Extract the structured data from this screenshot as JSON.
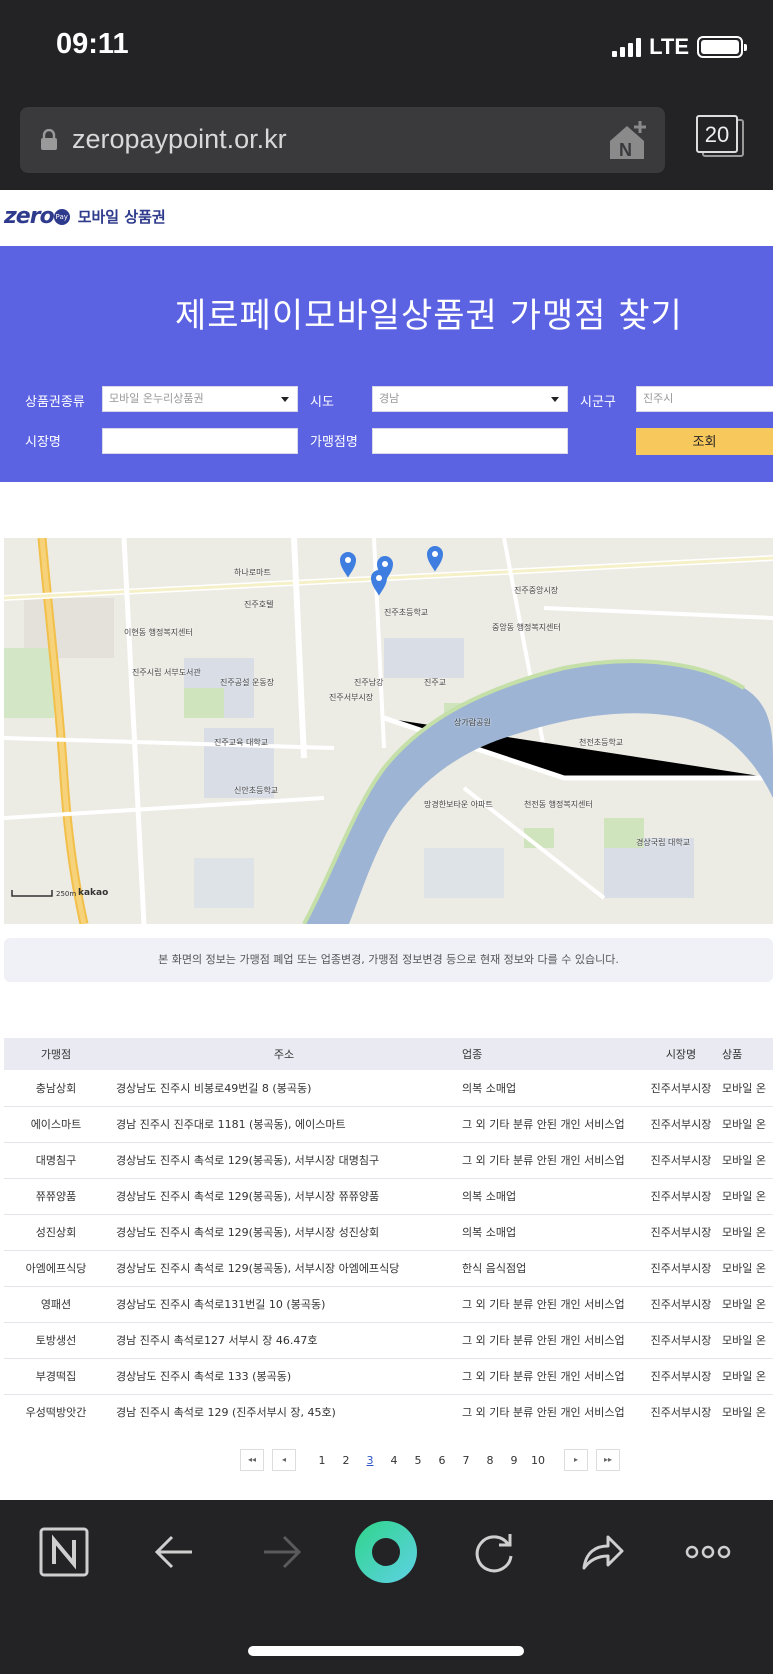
{
  "status_bar": {
    "time": "09:11",
    "network": "LTE"
  },
  "browser": {
    "url": "zeropaypoint.or.kr",
    "tab_count": "20"
  },
  "site": {
    "logo_word": "zero",
    "logo_pay": "Pay",
    "logo_text": "모바일 상품권"
  },
  "hero": {
    "title": "제로페이모바일상품권 가맹점 찾기",
    "labels": {
      "voucher_type": "상품권종류",
      "province": "시도",
      "district": "시군구",
      "market": "시장명",
      "store": "가맹점명"
    },
    "values": {
      "voucher_type": "모바일 온누리상품권",
      "province": "경남",
      "district": "진주시",
      "market": "",
      "store": ""
    },
    "search_button": "조회"
  },
  "map": {
    "scale": "250m",
    "brand": "kakao",
    "labels": [
      "이현동 행정복지센터",
      "진주시립 서부도서관",
      "진주공설 운동장",
      "신안초등학교",
      "진주교육 대학교",
      "망경한보타운 아파트",
      "천전동 행정복지센터",
      "경상국립 대학교",
      "상가람공원",
      "진주남강",
      "중앙동 행정복지센터",
      "진주초등학교",
      "하나로마트",
      "진주호텔",
      "진주교",
      "천전초등학교",
      "진주서부시장",
      "진주중앙시장"
    ]
  },
  "notice": "본 화면의 정보는 가맹점 폐업 또는 업종변경, 가맹점 정보변경 등으로 현재 정보와 다를 수 있습니다.",
  "table": {
    "headers": [
      "가맹점",
      "주소",
      "업종",
      "시장명",
      "상품"
    ],
    "rows": [
      {
        "name": "충남상회",
        "addr": "경상남도 진주시 비봉로49번길 8 (봉곡동)",
        "type": "의복 소매업",
        "market": "진주서부시장",
        "prod": "모바일 온"
      },
      {
        "name": "에이스마트",
        "addr": "경남 진주시 진주대로 1181 (봉곡동), 에이스마트",
        "type": "그 외 기타 분류 안된 개인 서비스업",
        "market": "진주서부시장",
        "prod": "모바일 온"
      },
      {
        "name": "대명침구",
        "addr": "경상남도 진주시 촉석로 129(봉곡동), 서부시장 대명침구",
        "type": "그 외 기타 분류 안된 개인 서비스업",
        "market": "진주서부시장",
        "prod": "모바일 온"
      },
      {
        "name": "쮸쮸양품",
        "addr": "경상남도 진주시 촉석로 129(봉곡동), 서부시장 쮸쮸양품",
        "type": "의복 소매업",
        "market": "진주서부시장",
        "prod": "모바일 온"
      },
      {
        "name": "성진상회",
        "addr": "경상남도 진주시 촉석로 129(봉곡동), 서부시장 성진상회",
        "type": "의복 소매업",
        "market": "진주서부시장",
        "prod": "모바일 온"
      },
      {
        "name": "아엠에프식당",
        "addr": "경상남도 진주시 촉석로 129(봉곡동), 서부시장 아엠에프식당",
        "type": "한식 음식점업",
        "market": "진주서부시장",
        "prod": "모바일 온"
      },
      {
        "name": "영패션",
        "addr": "경상남도 진주시 촉석로131번길 10 (봉곡동)",
        "type": "그 외 기타 분류 안된 개인 서비스업",
        "market": "진주서부시장",
        "prod": "모바일 온"
      },
      {
        "name": "토방생선",
        "addr": "경남 진주시 촉석로127 서부시 장 46.47호",
        "type": "그 외 기타 분류 안된 개인 서비스업",
        "market": "진주서부시장",
        "prod": "모바일 온"
      },
      {
        "name": "부경떡집",
        "addr": "경상남도 진주시 촉석로 133 (봉곡동)",
        "type": "그 외 기타 분류 안된 개인 서비스업",
        "market": "진주서부시장",
        "prod": "모바일 온"
      },
      {
        "name": "우성떡방앗간",
        "addr": "경남 진주시 촉석로 129 (진주서부시 장, 45호)",
        "type": "그 외 기타 분류 안된 개인 서비스업",
        "market": "진주서부시장",
        "prod": "모바일 온"
      }
    ]
  },
  "pagination": {
    "first": "◂◂",
    "prev": "◂",
    "pages": [
      "1",
      "2",
      "3",
      "4",
      "5",
      "6",
      "7",
      "8",
      "9",
      "10"
    ],
    "current": "3",
    "next": "▸",
    "last": "▸▸"
  },
  "colors": {
    "hero_bg": "#5b63e3",
    "search_btn": "#f7c85c",
    "brand": "#2e3a8c",
    "river": "#9db4d4",
    "dark_chrome": "#232326",
    "active_page": "#2d56c8"
  }
}
